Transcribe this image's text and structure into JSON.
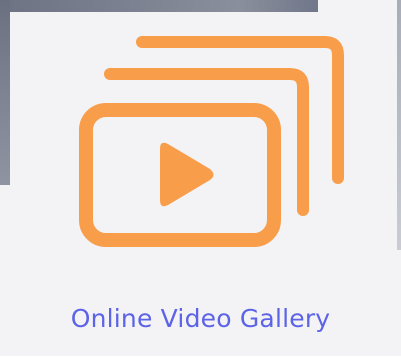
{
  "gallery": {
    "title": "Online Video Gallery",
    "icon": "video-gallery-icon",
    "colors": {
      "icon": "#f89d4a",
      "title": "#5d63e6",
      "background": "#f3f3f6"
    }
  }
}
